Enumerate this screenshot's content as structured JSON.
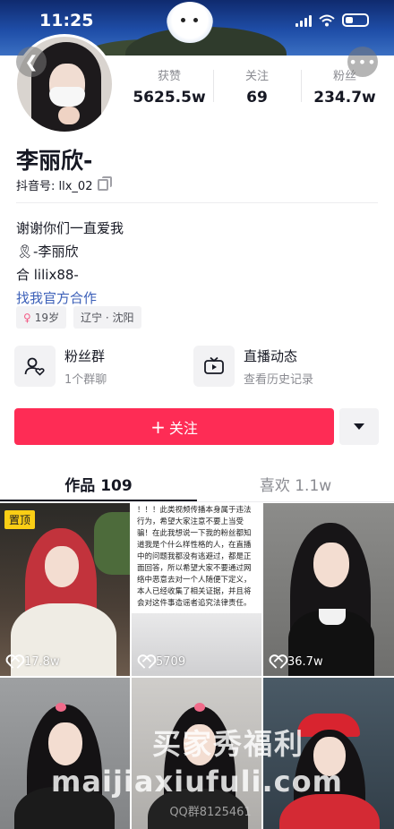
{
  "status_bar": {
    "time": "11:25"
  },
  "profile": {
    "stats": [
      {
        "label": "获赞",
        "value": "5625.5w"
      },
      {
        "label": "关注",
        "value": "69"
      },
      {
        "label": "粉丝",
        "value": "234.7w"
      }
    ],
    "name": "李丽欣-",
    "douyin_id": "抖音号: llx_02",
    "bio_lines": [
      "谢谢你们一直爱我",
      "🎗-李丽欣",
      "合 lilix88-"
    ],
    "bio_link": "找我官方合作",
    "tags": [
      {
        "icon": "female-gender-icon",
        "text": "19岁"
      },
      {
        "text": "辽宁 · 沈阳"
      }
    ]
  },
  "entries": [
    {
      "icon": "fan-group-icon",
      "title": "粉丝群",
      "subtitle": "1个群聊"
    },
    {
      "icon": "live-icon",
      "title": "直播动态",
      "subtitle": "查看历史记录"
    }
  ],
  "actions": {
    "follow_label": "关注"
  },
  "tabs": [
    {
      "label": "作品 109",
      "active": true
    },
    {
      "label": "喜欢 1.1w",
      "active": false
    }
  ],
  "videos": [
    {
      "likes": "17.8w",
      "pinned": true,
      "pin_label": "置顶"
    },
    {
      "likes": "5709",
      "text": "！！！此类视频传播本身属于违法行为，希望大家注意不要上当受骗！在此我想说一下我的粉丝都知道我是个什么样性格的人，在直播中的问题我都没有逃避过，都是正面回答，所以希望大家不要通过网络中恶意去对一个人随便下定义，本人已经收集了相关证据，并且将会对这件事造谣者追究法律责任。"
    },
    {
      "likes": "36.7w"
    },
    {
      "likes": ""
    },
    {
      "likes": ""
    },
    {
      "likes": ""
    }
  ],
  "watermark": {
    "line1": "买家秀福利",
    "line2": "maijiaxiufuli.com",
    "line3": "QQ群8125461"
  },
  "colors": {
    "accent": "#fe2c55",
    "link": "#3b5fb8",
    "pin": "#face15"
  }
}
